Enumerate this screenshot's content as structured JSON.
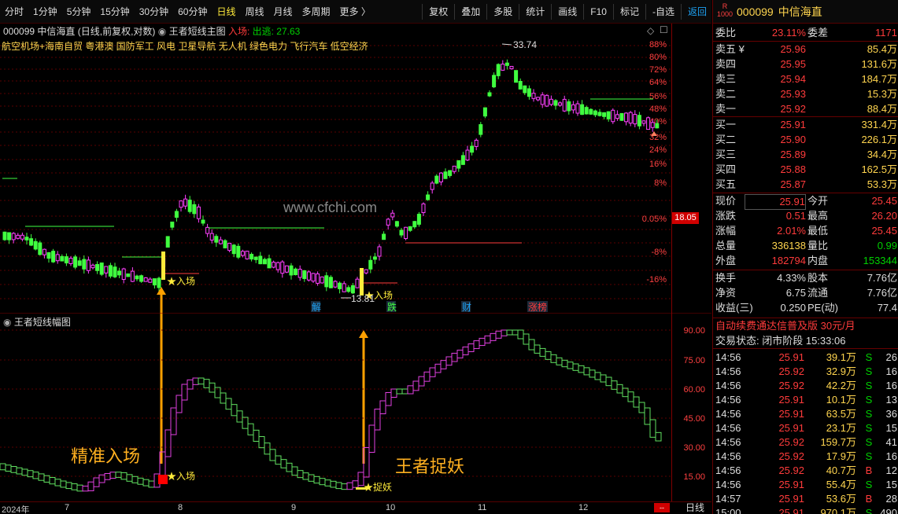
{
  "toolbar": {
    "items": [
      "分时",
      "1分钟",
      "5分钟",
      "15分钟",
      "30分钟",
      "60分钟",
      "日线",
      "周线",
      "月线",
      "多周期",
      "更多 〉"
    ],
    "active": "日线",
    "right_items": [
      "复权",
      "叠加",
      "多股",
      "统计",
      "画线",
      "F10",
      "标记",
      "-自选",
      "返回"
    ]
  },
  "chart": {
    "title_code": "000099",
    "title_name": "中信海直",
    "title_mode": "(日线,前复权,对数)",
    "indicator_name": "王者短线主图",
    "entry_label": "入场:",
    "exit_label": "出逃: 27.63",
    "concepts": "航空机场+海南自贸  粤港澳  国防军工  风电  卫星导航  无人机  绿色电力  飞行汽车  低空经济",
    "high_label": "33.74",
    "low_label": "13.81",
    "watermark": "www.cfchi.com",
    "entry_marks": [
      "★入场",
      "★入场"
    ],
    "event_labels": [
      "解",
      "跌",
      "财",
      "涨榜"
    ],
    "current_price_tag": "18.05",
    "right_axis": [
      "88%",
      "80%",
      "72%",
      "64%",
      "56%",
      "48%",
      "40%",
      "32%",
      "24%",
      "16%",
      "8%",
      "0.05%",
      "-8%",
      "-16%"
    ]
  },
  "subchart": {
    "title": "王者短线幅图",
    "right_axis": [
      "90.00",
      "75.00",
      "60.00",
      "45.00",
      "30.00",
      "15.00"
    ],
    "mark_entry": "★入场",
    "mark_catch": "★捉妖",
    "annotation_left": "精准入场",
    "annotation_right": "王者捉妖"
  },
  "bottom": {
    "dates": [
      "2024年",
      "7",
      "8",
      "9",
      "10",
      "11",
      "12"
    ],
    "period": "日线",
    "red_label": "--"
  },
  "panel": {
    "code": "000099",
    "name": "中信海直",
    "logo_top": "R",
    "logo_bottom": "1000",
    "weibi_label": "委比",
    "weibi": "23.11%",
    "weicha_label": "委差",
    "weicha": "1171",
    "asks": [
      {
        "label": "卖五 ¥",
        "price": "25.96",
        "vol": "85.4万"
      },
      {
        "label": "卖四",
        "price": "25.95",
        "vol": "131.6万"
      },
      {
        "label": "卖三",
        "price": "25.94",
        "vol": "184.7万"
      },
      {
        "label": "卖二",
        "price": "25.93",
        "vol": "15.3万"
      },
      {
        "label": "卖一",
        "price": "25.92",
        "vol": "88.4万"
      }
    ],
    "bids": [
      {
        "label": "买一",
        "price": "25.91",
        "vol": "331.4万"
      },
      {
        "label": "买二",
        "price": "25.90",
        "vol": "226.1万"
      },
      {
        "label": "买三",
        "price": "25.89",
        "vol": "34.4万"
      },
      {
        "label": "买四",
        "price": "25.88",
        "vol": "162.5万"
      },
      {
        "label": "买五",
        "price": "25.87",
        "vol": "53.3万"
      }
    ],
    "stats": [
      {
        "l1": "现价",
        "v1": "25.91",
        "c1": "red",
        "l2": "今开",
        "v2": "25.45",
        "c2": "red"
      },
      {
        "l1": "涨跌",
        "v1": "0.51",
        "c1": "red",
        "l2": "最高",
        "v2": "26.20",
        "c2": "red"
      },
      {
        "l1": "涨幅",
        "v1": "2.01%",
        "c1": "red",
        "l2": "最低",
        "v2": "25.45",
        "c2": "red"
      },
      {
        "l1": "总量",
        "v1": "336138",
        "c1": "yellow",
        "l2": "量比",
        "v2": "0.99",
        "c2": "green"
      },
      {
        "l1": "外盘",
        "v1": "182794",
        "c1": "red",
        "l2": "内盘",
        "v2": "153344",
        "c2": "green"
      }
    ],
    "stats2": [
      {
        "l1": "换手",
        "v1": "4.33%",
        "l2": "股本",
        "v2": "7.76亿"
      },
      {
        "l1": "净资",
        "v1": "6.75",
        "l2": "流通",
        "v2": "7.76亿"
      },
      {
        "l1": "收益(三)",
        "v1": "0.250",
        "l2": "PE(动)",
        "v2": "77.4"
      }
    ],
    "promo": "自动续费通达信普及版  30元/月",
    "trade_status": "交易状态: 闭市阶段 15:33:06",
    "ticks": [
      {
        "t": "14:56",
        "p": "25.91",
        "v": "39.1万",
        "bs": "S",
        "n": "26"
      },
      {
        "t": "14:56",
        "p": "25.92",
        "v": "32.9万",
        "bs": "S",
        "n": "16"
      },
      {
        "t": "14:56",
        "p": "25.92",
        "v": "42.2万",
        "bs": "S",
        "n": "16"
      },
      {
        "t": "14:56",
        "p": "25.91",
        "v": "10.1万",
        "bs": "S",
        "n": "13"
      },
      {
        "t": "14:56",
        "p": "25.91",
        "v": "63.5万",
        "bs": "S",
        "n": "36"
      },
      {
        "t": "14:56",
        "p": "25.91",
        "v": "23.1万",
        "bs": "S",
        "n": "15"
      },
      {
        "t": "14:56",
        "p": "25.92",
        "v": "159.7万",
        "bs": "S",
        "n": "41"
      },
      {
        "t": "14:56",
        "p": "25.92",
        "v": "17.9万",
        "bs": "S",
        "n": "16"
      },
      {
        "t": "14:56",
        "p": "25.92",
        "v": "40.7万",
        "bs": "B",
        "n": "12"
      },
      {
        "t": "14:56",
        "p": "25.91",
        "v": "55.4万",
        "bs": "S",
        "n": "15"
      },
      {
        "t": "14:57",
        "p": "25.91",
        "v": "53.6万",
        "bs": "B",
        "n": "28"
      },
      {
        "t": "15:00",
        "p": "25.91",
        "v": "970.1万",
        "bs": "S",
        "n": "490"
      }
    ]
  }
}
